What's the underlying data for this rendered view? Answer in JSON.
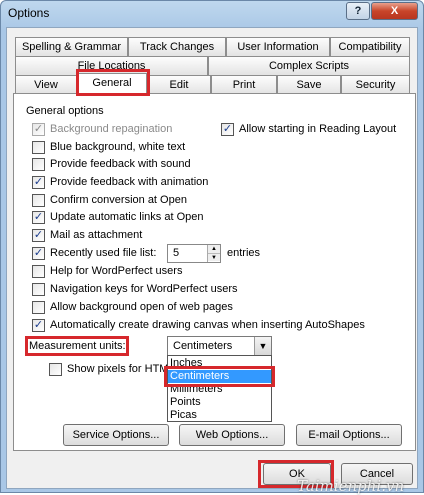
{
  "window": {
    "title": "Options",
    "help_label": "?",
    "close_label": "X"
  },
  "tabs": {
    "row1": [
      "Spelling & Grammar",
      "Track Changes",
      "User Information",
      "Compatibility"
    ],
    "row2": [
      "File Locations",
      "Complex Scripts"
    ],
    "row3": [
      "View",
      "General",
      "Edit",
      "Print",
      "Save",
      "Security"
    ],
    "active": "General"
  },
  "general": {
    "group_label": "General options",
    "options": [
      {
        "label": "Background repagination",
        "checked": true,
        "disabled": true
      },
      {
        "label": "Blue background, white text",
        "checked": false
      },
      {
        "label": "Provide feedback with sound",
        "checked": false
      },
      {
        "label": "Provide feedback with animation",
        "checked": true
      },
      {
        "label": "Confirm conversion at Open",
        "checked": false
      },
      {
        "label": "Update automatic links at Open",
        "checked": true
      },
      {
        "label": "Mail as attachment",
        "checked": true
      },
      {
        "label": "Recently used file list:",
        "checked": true
      },
      {
        "label": "Help for WordPerfect users",
        "checked": false
      },
      {
        "label": "Navigation keys for WordPerfect users",
        "checked": false
      },
      {
        "label": "Allow background open of web pages",
        "checked": false
      },
      {
        "label": "Automatically create drawing canvas when inserting AutoShapes",
        "checked": true
      }
    ],
    "reading_layout": {
      "label": "Allow starting in Reading Layout",
      "checked": true
    },
    "recent_files_count": "5",
    "entries_label": "entries",
    "measurement_label": "Measurement units:",
    "measurement_value": "Centimeters",
    "show_pixels_label": "Show pixels for HTML features",
    "show_pixels_checked": false,
    "units_options": [
      "Inches",
      "Centimeters",
      "Millimeters",
      "Points",
      "Picas"
    ],
    "units_selected": "Centimeters"
  },
  "buttons": {
    "service": "Service Options...",
    "web": "Web Options...",
    "email": "E-mail Options...",
    "ok": "OK",
    "cancel": "Cancel"
  },
  "watermark": "Taimienphi.vn",
  "colors": {
    "highlight": "#d6282c",
    "selection": "#3399ff"
  },
  "icons": {
    "checkmark": "✓",
    "dropdown": "▼",
    "spin_up": "▲",
    "spin_down": "▼"
  }
}
